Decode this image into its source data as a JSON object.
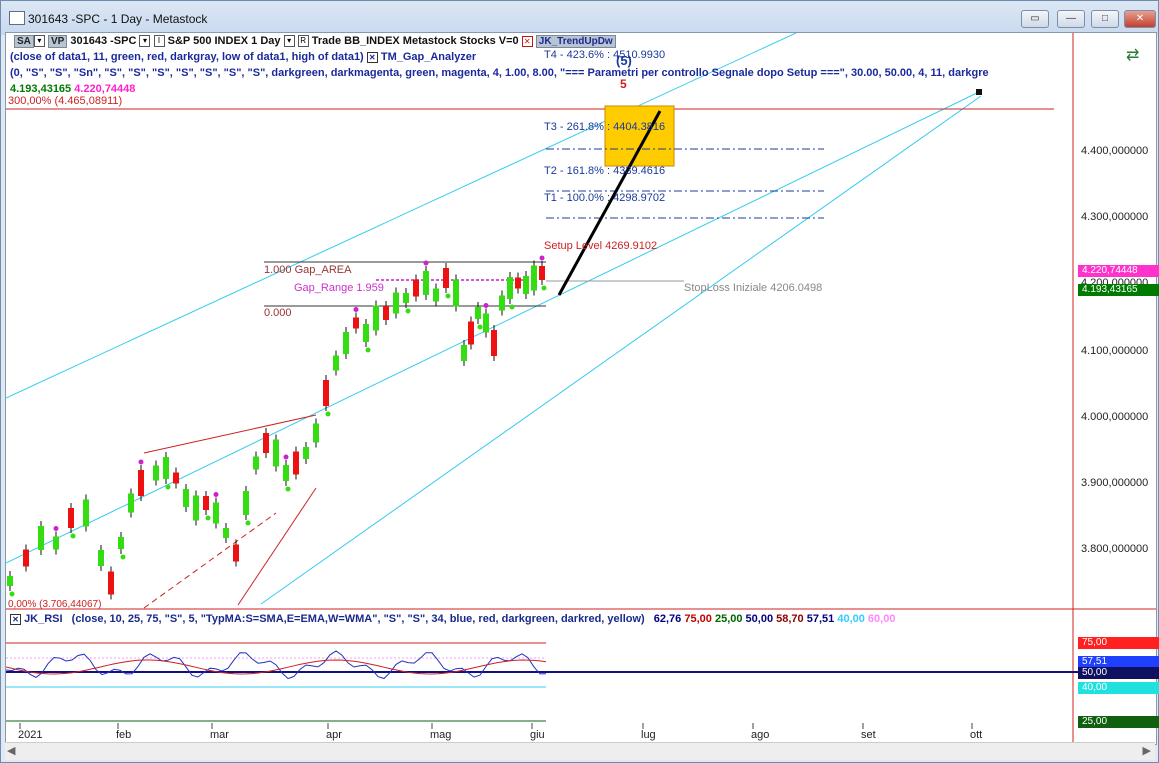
{
  "window": {
    "title": "301643 -SPC - 1 Day - Metastock",
    "buttons": [
      "restore-down",
      "minimize",
      "maximize",
      "close"
    ]
  },
  "toolbar": {
    "sa_badge": "SA",
    "vp_badge": "VP",
    "symbol": "301643 -SPC",
    "security_line": "S&P 500 INDEX  1 Day",
    "r_label": "R",
    "trade_label": "Trade  BB_INDEX  Metastock  Stocks  V=0",
    "indicator_badge": "JK_TrendUpDw"
  },
  "header": {
    "line2_a": "(close of data1,  11,  green,  red,  darkgray,  low of data1,  high of data1)",
    "line2_b": "TM_Gap_Analyzer",
    "line3": "(0,  \"S\",  \"S\",  \"Sn\",  \"S\",  \"S\",  \"S\",  \"S\",  \"S\",  \"S\",  \"S\",  darkgreen,  darkmagenta,  green,  magenta,  4,  1.00,  8.00,  \"=== Parametri per controllo Segnale dopo Setup ===\",  30.00,  50.00,  4,  11,  darkgre",
    "value_green": "4.193,43165",
    "value_magenta": "4.220,74448",
    "fib_300": "300,00% (4.465,08911)"
  },
  "annotations": {
    "t4": "T4 - 423.6% : 4510.9930",
    "t3": "T3 - 261.8% : 4404.3816",
    "t2": "T2 - 161.8% : 4339.4616",
    "t1": "T1 - 100.0% : 4298.9702",
    "setup": "Setup Level 4269.9102",
    "stoploss": "StopLoss Iniziale 4206.0498",
    "gap_area": "1.000 Gap_AREA",
    "gap_range": "Gap_Range 1.959",
    "gap_zero": "0.000",
    "wave_label": "(5)",
    "wave_label_red": "5",
    "fib_bottom": "0,00% (3.706,44067)"
  },
  "price_axis": {
    "ticks": [
      "4.400,000000",
      "4.300,000000",
      "4.200,000000",
      "4.100,000000",
      "4.000,000000",
      "3.900,000000",
      "3.800,000000"
    ],
    "tags": [
      {
        "text": "4.220,74448",
        "color": "#ff33cc"
      },
      {
        "text": "4.193,43165",
        "color": "#007a00"
      }
    ]
  },
  "rsi_panel": {
    "name": "JK_RSI",
    "params": "(close,  10,  25,  75,  \"S\",  5,  \"TypMA:S=SMA,E=EMA,W=WMA\",  \"S\",  \"S\",  34,  blue,  red,  darkgreen,  darkred,  yellow)",
    "values": [
      {
        "text": "62,76",
        "color": "#000080"
      },
      {
        "text": "75,00",
        "color": "#c00000"
      },
      {
        "text": "25,00",
        "color": "#006400"
      },
      {
        "text": "50,00",
        "color": "#000080"
      },
      {
        "text": "58,70",
        "color": "#8b0000"
      },
      {
        "text": "57,51",
        "color": "#000080"
      },
      {
        "text": "40,00",
        "color": "#33ccff"
      },
      {
        "text": "60,00",
        "color": "#ff88ff"
      }
    ],
    "axis_tags": [
      {
        "text": "75,00",
        "color": "#ff2020"
      },
      {
        "text": "57,51",
        "color": "#2040ff"
      },
      {
        "text": "50,00",
        "color": "#101060"
      },
      {
        "text": "40,00",
        "color": "#20e0e0"
      },
      {
        "text": "25,00",
        "color": "#106010"
      }
    ]
  },
  "time_axis": {
    "months": [
      "2021",
      "feb",
      "mar",
      "apr",
      "mag",
      "giu",
      "lug",
      "ago",
      "set",
      "ott"
    ]
  },
  "colors": {
    "bull": "#33dd11",
    "bear": "#ee1111",
    "channel": "#33ccee",
    "target_box": "#ffcc00",
    "annotation_blue": "#1a3a9a"
  }
}
